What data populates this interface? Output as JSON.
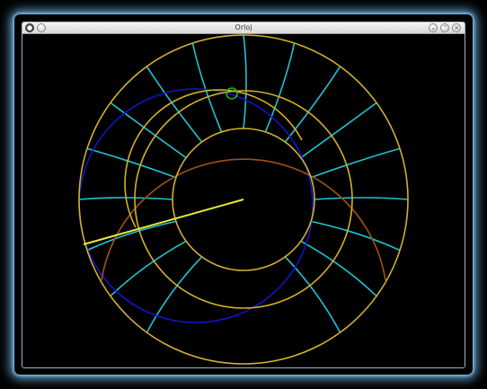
{
  "window": {
    "title": "Orloj",
    "menu_icon": "app-menu-icon",
    "sticky_icon": "sticky-icon",
    "minimize_icon": "minimize-icon",
    "maximize_icon": "maximize-icon",
    "close_icon": "close-icon"
  },
  "astrolabe": {
    "colors": {
      "background": "#000000",
      "rings": "#d4b02a",
      "hour_lines": "#1fc4d2",
      "ecliptic": "#1414c8",
      "horizon_arc": "#a05214",
      "hand": "#e8e83a",
      "sun_marker": "#22b422"
    }
  }
}
